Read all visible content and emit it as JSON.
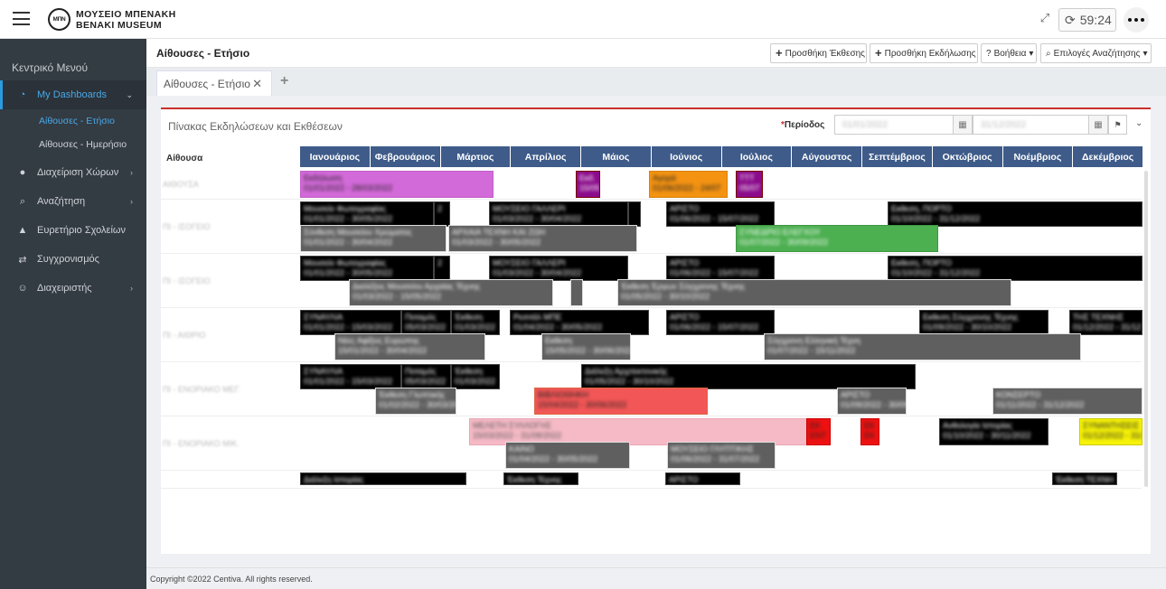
{
  "brand": {
    "line1": "ΜΟΥΣΕΙΟ ΜΠΕΝΑΚΗ",
    "line2": "BENAKI MUSEUM",
    "mark": "ΜΠΝ"
  },
  "header": {
    "timer": "59:24"
  },
  "sidebar": {
    "title": "Κεντρικό Μενού",
    "items": [
      {
        "label": "My Dashboards",
        "icon": "dashboard-icon",
        "active": true
      },
      {
        "label": "Διαχείριση Χώρων",
        "icon": "map-pin-icon"
      },
      {
        "label": "Αναζήτηση",
        "icon": "search-icon"
      },
      {
        "label": "Ευρετήριο Σχολείων",
        "icon": "graduation-cap-icon"
      },
      {
        "label": "Συγχρονισμός",
        "icon": "sync-arrows-icon"
      },
      {
        "label": "Διαχειριστής",
        "icon": "user-icon"
      }
    ],
    "subitems": [
      {
        "label": "Αίθουσες - Ετήσιο",
        "active": true
      },
      {
        "label": "Αίθουσες - Ημερήσιο"
      }
    ]
  },
  "page": {
    "title": "Αίθουσες - Ετήσιο",
    "buttons": {
      "add_exhibition": "Προσθήκη Έκθεσης",
      "add_event": "Προσθήκη Εκδήλωσης",
      "help": "Βοήθεια",
      "search_options": "Επιλογές Αναζήτησης"
    },
    "tab_label": "Αίθουσες - Ετήσιο"
  },
  "panel": {
    "title": "Πίνακας Εκδηλώσεων και Εκθέσεων",
    "period_label": "Περίοδος",
    "date_from": "01/01/2022",
    "date_to": "31/12/2022",
    "hall_header": "Αίθουσα"
  },
  "months": [
    "Ιανουάριος",
    "Φεβρουάριος",
    "Μάρτιος",
    "Απρίλιος",
    "Μάιος",
    "Ιούνιος",
    "Ιούλιος",
    "Αύγουστος",
    "Σεπτέμβριος",
    "Οκτώβριος",
    "Νοέμβριος",
    "Δεκέμβριος"
  ],
  "halls": [
    "ΑΙΘΟΥΣΑ",
    "ΠΙ - ΙΣΟΓΕΙΟ",
    "ΠΙ - ΙΣΟΓΕΙΟ",
    "ΠΙ - ΑΙΘΡΙΟ",
    "ΠΙ - ΕΝΟΡΙΑΚΟ ΜΕΓ.",
    "ΠΙ - ΕΝΟΡΙΑΚΟ ΜΙΚ.",
    ""
  ],
  "bookings": [
    {
      "label": "Εκδήλωση",
      "dates": "01/01/2022 - 28/03/2022",
      "color": "magenta"
    },
    {
      "label": "Εκδ.",
      "dates": "15/05",
      "color": "purple"
    },
    {
      "label": "Αγορά",
      "dates": "01/06/2022 - 24/07",
      "color": "orange"
    },
    {
      "label": "ΤΤΤ",
      "dates": "05/07",
      "color": "purple"
    },
    {
      "label": "Μουσείο Φωτογραφίας",
      "dates": "01/01/2022 - 30/05/2022",
      "color": "black"
    },
    {
      "label": "2",
      "dates": "",
      "color": "black"
    },
    {
      "label": "ΜΟΥΣΕΙΟ ΓΑΛΛΕΡΙ",
      "dates": "01/03/2022 - 30/04/2022",
      "color": "black"
    },
    {
      "label": "",
      "dates": "",
      "color": "black"
    },
    {
      "label": "ΑΡΙΣΤΟ",
      "dates": "01/06/2022 - 15/07/2022",
      "color": "black"
    },
    {
      "label": "Εκθεση, ΠΟΡΤΟ",
      "dates": "01/10/2022 - 31/12/2022",
      "color": "black"
    },
    {
      "label": "Σύνθεση Μουσείου Χρώματος",
      "dates": "01/01/2022 - 30/04/2022",
      "color": "grey"
    },
    {
      "label": "ΑΡΧΑΙΑ ΤΕΧΝΗ ΚΑΙ ΖΩΗ",
      "dates": "01/03/2022 - 30/05/2022",
      "color": "grey"
    },
    {
      "label": "ΣΥΝΕΔΡΙΟ ΕΛΕΓΧΟΥ",
      "dates": "01/07/2022 - 30/09/2022",
      "color": "green"
    },
    {
      "label": "Μουσείο Φωτογραφίας",
      "dates": "01/01/2022 - 30/05/2022",
      "color": "black"
    },
    {
      "label": "2",
      "dates": "",
      "color": "black"
    },
    {
      "label": "ΜΟΥΣΕΙΟ ΓΑΛΛΕΡΙ",
      "dates": "01/03/2022 - 30/04/2022",
      "color": "black"
    },
    {
      "label": "ΑΡΙΣΤΟ",
      "dates": "01/06/2022 - 15/07/2022",
      "color": "black"
    },
    {
      "label": "Εκθεση, ΠΟΡΤΟ",
      "dates": "01/10/2022 - 31/12/2022",
      "color": "black"
    },
    {
      "label": "Διαλέξεις Μουσείου Αρχαίας Τέχνης",
      "dates": "01/03/2022 - 15/05/2022",
      "color": "grey"
    },
    {
      "label": "",
      "dates": "",
      "color": "grey"
    },
    {
      "label": "Έκθεση Έργων Σύγχρονης Τέχνης",
      "dates": "01/05/2022 - 30/10/2022",
      "color": "grey"
    },
    {
      "label": "ΣΥΝΑΥΛΙΑ",
      "dates": "01/01/2022 - 15/03/2022",
      "color": "black"
    },
    {
      "label": "Ποταμός",
      "dates": "05/03/2022",
      "color": "black"
    },
    {
      "label": "Έκθεση",
      "dates": "01/03/2022",
      "color": "black"
    },
    {
      "label": "Ρεσιτάλ ΜΠΕ",
      "dates": "01/04/2022 - 30/05/2022",
      "color": "black"
    },
    {
      "label": "ΑΡΙΣΤΟ",
      "dates": "01/06/2022 - 15/07/2022",
      "color": "black"
    },
    {
      "label": "Εκθεση Σύγχρονης Τέχνης",
      "dates": "01/09/2022 - 30/10/2022",
      "color": "black"
    },
    {
      "label": "ΤΗΣ ΤΕΧΝΗΣ",
      "dates": "01/12/2022 - 31/12",
      "color": "black"
    },
    {
      "label": "Νέες Αφίξεις Ευρώπης",
      "dates": "15/01/2022 - 30/04/2022",
      "color": "grey"
    },
    {
      "label": "Εκθεση",
      "dates": "15/05/2022 - 30/06/2022",
      "color": "grey"
    },
    {
      "label": "Σύγχρονη Ελληνική Τέχνη",
      "dates": "01/07/2022 - 15/11/2022",
      "color": "grey"
    },
    {
      "label": "ΣΥΝΑΥΛΙΑ",
      "dates": "01/01/2022 - 15/03/2022",
      "color": "black"
    },
    {
      "label": "Ποταμός",
      "dates": "05/03/2022",
      "color": "black"
    },
    {
      "label": "Έκθεση",
      "dates": "01/03/2022",
      "color": "black"
    },
    {
      "label": "Διάλεξη Αρχιτεκτονικής",
      "dates": "01/05/2022 - 30/10/2022",
      "color": "black"
    },
    {
      "label": "Έκθεση Γλυπτικής",
      "dates": "01/02/2022 - 30/03/2022",
      "color": "grey"
    },
    {
      "label": "ΒΙΒΛΙΟΘΗΚΗ",
      "dates": "15/04/2022 - 30/06/2022",
      "color": "red"
    },
    {
      "label": "ΑΡΙΣΤΟ",
      "dates": "01/09/2022 - 30/09",
      "color": "grey"
    },
    {
      "label": "ΚΟΝΣΕΡΤΟ",
      "dates": "01/11/2022 - 31/12/2022",
      "color": "grey"
    },
    {
      "label": "ΜΕΛΕΤΗ ΣΥΛΛΟΓΗΣ",
      "dates": "15/03/2022 - 31/08/2022",
      "color": "pink"
    },
    {
      "label": "ΕΚ",
      "dates": "ΕΝΤ",
      "color": "redsolid"
    },
    {
      "label": "ΕΚ",
      "dates": "ΕΚ",
      "color": "redsolid"
    },
    {
      "label": "Ανθολογία Ιστορίας",
      "dates": "01/10/2022 - 30/11/2022",
      "color": "black"
    },
    {
      "label": "ΣΥΝΑΝΤΗΣΕΙΣ",
      "dates": "01/12/2022 - 31/12",
      "color": "yellow"
    },
    {
      "label": "ΚΑΙΝΟ",
      "dates": "01/04/2022 - 30/05/2022",
      "color": "grey"
    },
    {
      "label": "ΜΟΥΣΕΙΟ ΓΛΥΠΤΙΚΗΣ",
      "dates": "01/06/2022 - 31/07/2022",
      "color": "grey"
    },
    {
      "label": "Διάλεξη Ιστορίας",
      "dates": "",
      "color": "black"
    },
    {
      "label": "Έκθεση Τέχνης",
      "dates": "",
      "color": "black"
    },
    {
      "label": "ΑΡΙΣΤΟ",
      "dates": "",
      "color": "black"
    },
    {
      "label": "Έκθεση ΤΕΧΝΗ",
      "dates": "",
      "color": "black"
    }
  ],
  "footer": {
    "copyright": "Copyright ©2022 Centiva. All rights reserved."
  }
}
